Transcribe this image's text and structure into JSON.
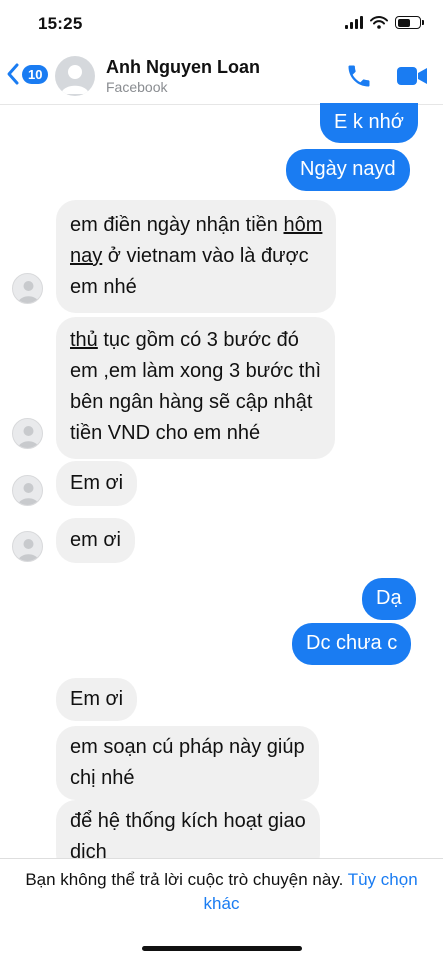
{
  "status": {
    "time": "15:25"
  },
  "header": {
    "back_count": "10",
    "name": "Anh Nguyen Loan",
    "subtitle": "Facebook"
  },
  "messages": {
    "m1": "E k nhớ",
    "m2": "Ngày nayd",
    "m3": {
      "l1a": "em điền ngày nhận tiền ",
      "l1b": "hôm",
      "l2a": "nay",
      "l2b": " ở vietnam vào là được",
      "l3": "em nhé"
    },
    "m4": {
      "l1a": "thủ",
      "l1b": " tục gồm có 3 bước đó",
      "l2": "em ,em làm xong 3 bước thì",
      "l3": "bên ngân hàng sẽ cập nhật",
      "l4": "tiền VND cho em nhé"
    },
    "m5": "Em ơi",
    "m6": "em ơi",
    "m7": "Dạ",
    "m8": "Dc chưa c",
    "m9": "Em ơi",
    "m10": {
      "l1": "em soạn cú pháp này giúp",
      "l2": "chị nhé"
    },
    "m11": {
      "l1": "để hệ thống kích hoạt giao",
      "l2": "dịch"
    }
  },
  "footer": {
    "notice": "Bạn không thể trả lời cuộc trò chuyện này.",
    "link": "Tùy chọn khác"
  },
  "colors": {
    "accent": "#1a7cf2",
    "incoming_bubble": "#f0f0f0"
  }
}
